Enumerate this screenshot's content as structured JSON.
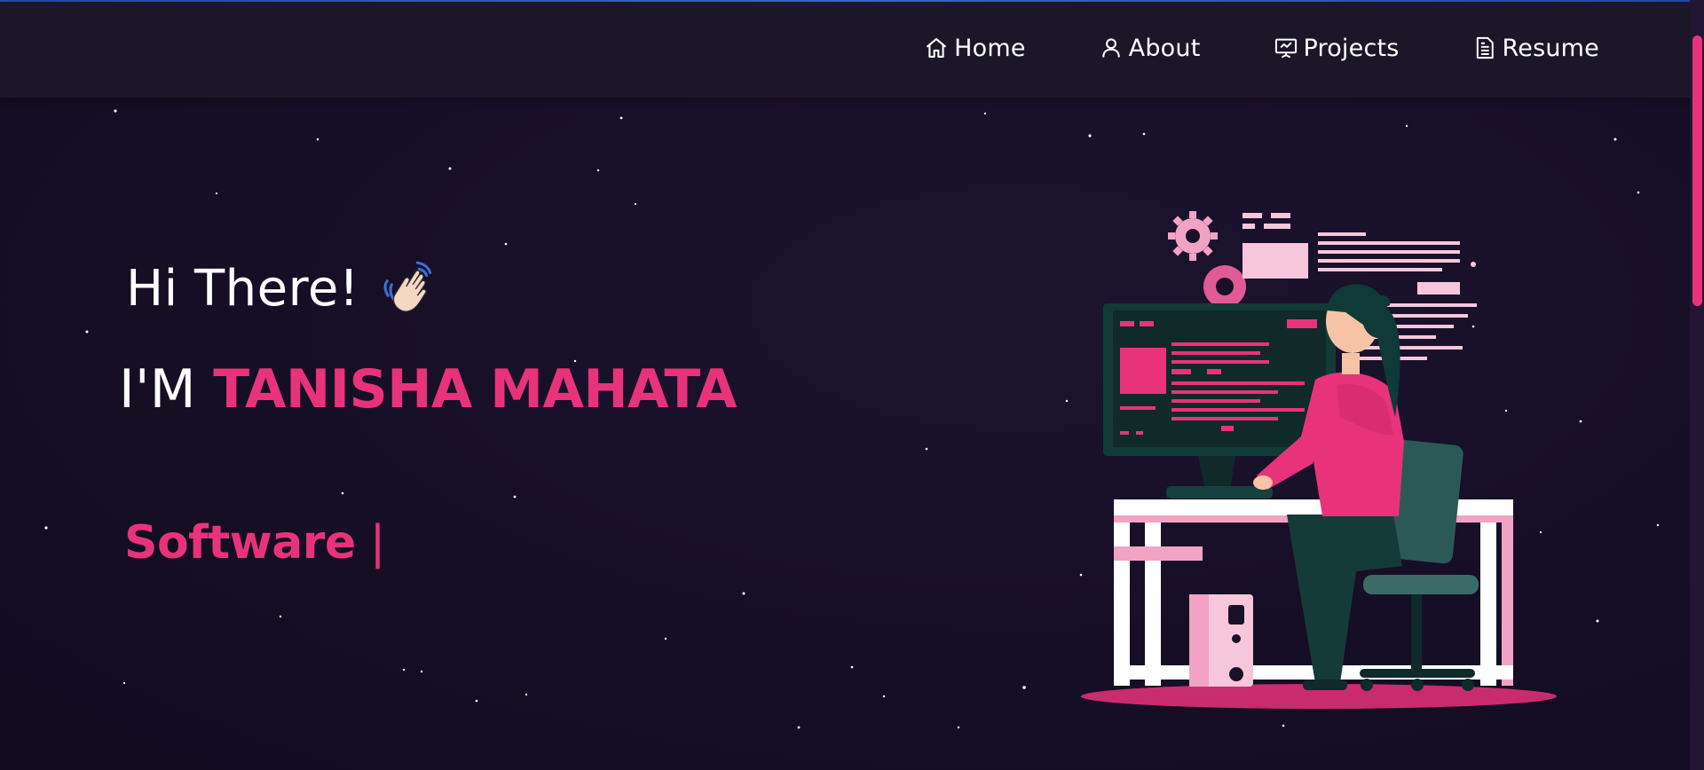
{
  "nav": {
    "items": [
      {
        "label": "Home",
        "icon": "home-icon"
      },
      {
        "label": "About",
        "icon": "user-icon"
      },
      {
        "label": "Projects",
        "icon": "presentation-icon"
      },
      {
        "label": "Resume",
        "icon": "document-icon"
      }
    ]
  },
  "hero": {
    "greeting": "Hi There!",
    "wave_icon": "waving-hand-icon",
    "name_prefix": "I'M",
    "name": "TANISHA MAHATA",
    "typed_text": "Software",
    "cursor": "|"
  },
  "colors": {
    "accent": "#e8337a",
    "background": "#170f26",
    "navbar": "#1b1728",
    "text": "#ffffff"
  }
}
